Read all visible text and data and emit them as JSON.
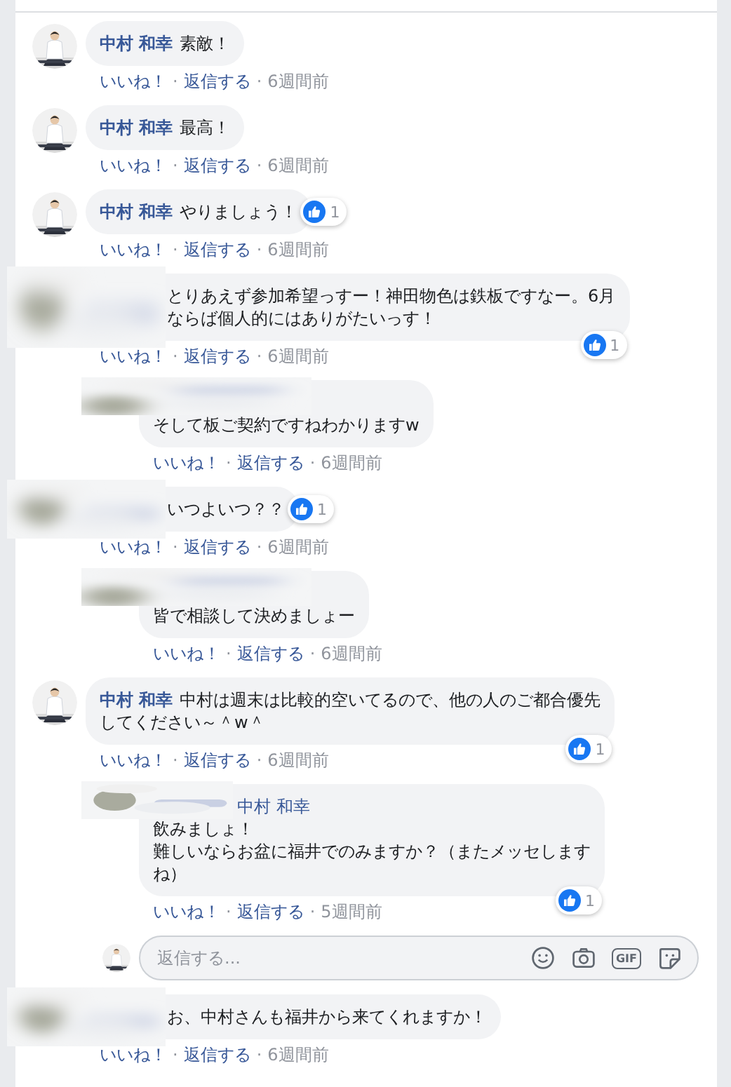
{
  "comments": [
    {
      "author": "中村 和幸",
      "lines": [
        "素敵！"
      ],
      "meta": [
        {
          "kind": "link",
          "text": "いいね！"
        },
        {
          "kind": "dot",
          "text": "·"
        },
        {
          "kind": "link",
          "text": "返信する"
        },
        {
          "kind": "dot",
          "text": "·"
        },
        {
          "kind": "time",
          "text": "6週間前"
        }
      ]
    },
    {
      "author": "中村 和幸",
      "lines": [
        "最高！"
      ],
      "meta": [
        {
          "kind": "link",
          "text": "いいね！"
        },
        {
          "kind": "dot",
          "text": "·"
        },
        {
          "kind": "link",
          "text": "返信する"
        },
        {
          "kind": "dot",
          "text": "·"
        },
        {
          "kind": "time",
          "text": "6週間前"
        }
      ]
    },
    {
      "author": "中村 和幸",
      "lines": [
        "やりましょう！"
      ],
      "likes": {
        "count": "1",
        "kind": "inline"
      },
      "meta": [
        {
          "kind": "link",
          "text": "いいね！"
        },
        {
          "kind": "dot",
          "text": "·"
        },
        {
          "kind": "link",
          "text": "返信する"
        },
        {
          "kind": "dot",
          "text": "·"
        },
        {
          "kind": "time",
          "text": "6週間前"
        }
      ]
    },
    {
      "lines": [
        "とりあえず参加希望っすー！神田物色は鉄板ですなー。6月",
        "ならば個人的にはありがたいっす！"
      ],
      "likes": {
        "count": "1",
        "kind": "corner"
      },
      "meta": [
        {
          "kind": "link",
          "text": "いいね！"
        },
        {
          "kind": "dot",
          "text": "·"
        },
        {
          "kind": "link",
          "text": "返信する"
        },
        {
          "kind": "dot",
          "text": "·"
        },
        {
          "kind": "time",
          "text": "6週間前"
        }
      ],
      "replies": [
        {
          "lines": [
            "そして板ご契約ですねわかりますw"
          ],
          "meta": [
            {
              "kind": "link",
              "text": "いいね！"
            },
            {
              "kind": "dot",
              "text": "·"
            },
            {
              "kind": "link",
              "text": "返信する"
            },
            {
              "kind": "dot",
              "text": "·"
            },
            {
              "kind": "time",
              "text": "6週間前"
            }
          ]
        }
      ]
    },
    {
      "lines": [
        "いつよいつ？？"
      ],
      "likes": {
        "count": "1",
        "kind": "inline"
      },
      "meta": [
        {
          "kind": "link",
          "text": "いいね！"
        },
        {
          "kind": "dot",
          "text": "·"
        },
        {
          "kind": "link",
          "text": "返信する"
        },
        {
          "kind": "dot",
          "text": "·"
        },
        {
          "kind": "time",
          "text": "6週間前"
        }
      ],
      "replies": [
        {
          "lines": [
            "皆で相談して決めましょー"
          ],
          "meta": [
            {
              "kind": "link",
              "text": "いいね！"
            },
            {
              "kind": "dot",
              "text": "·"
            },
            {
              "kind": "link",
              "text": "返信する"
            },
            {
              "kind": "dot",
              "text": "·"
            },
            {
              "kind": "time",
              "text": "6週間前"
            }
          ]
        }
      ]
    },
    {
      "author": "中村 和幸",
      "lines": [
        "中村は週末は比較的空いてるので、他の人のご都合優先",
        "してください～＾w＾"
      ],
      "likes": {
        "count": "1",
        "kind": "corner"
      },
      "meta": [
        {
          "kind": "link",
          "text": "いいね！"
        },
        {
          "kind": "dot",
          "text": "·"
        },
        {
          "kind": "link",
          "text": "返信する"
        },
        {
          "kind": "dot",
          "text": "·"
        },
        {
          "kind": "time",
          "text": "6週間前"
        }
      ],
      "replies": [
        {
          "mention": "中村 和幸",
          "lines": [
            "飲みましょ！",
            "難しいならお盆に福井でのみますか？（またメッセします",
            "ね）"
          ],
          "likes": {
            "count": "1",
            "kind": "corner"
          },
          "meta": [
            {
              "kind": "link",
              "text": "いいね！"
            },
            {
              "kind": "dot",
              "text": "·"
            },
            {
              "kind": "link",
              "text": "返信する"
            },
            {
              "kind": "dot",
              "text": "·"
            },
            {
              "kind": "time",
              "text": "5週間前"
            }
          ]
        }
      ],
      "reply_box": {
        "placeholder": "返信する...",
        "gif": "GIF"
      }
    },
    {
      "lines": [
        "お、中村さんも福井から来てくれますか！"
      ],
      "meta": [
        {
          "kind": "link",
          "text": "いいね！"
        },
        {
          "kind": "dot",
          "text": "·"
        },
        {
          "kind": "link",
          "text": "返信する"
        },
        {
          "kind": "dot",
          "text": "·"
        },
        {
          "kind": "time",
          "text": "6週間前"
        }
      ]
    }
  ]
}
